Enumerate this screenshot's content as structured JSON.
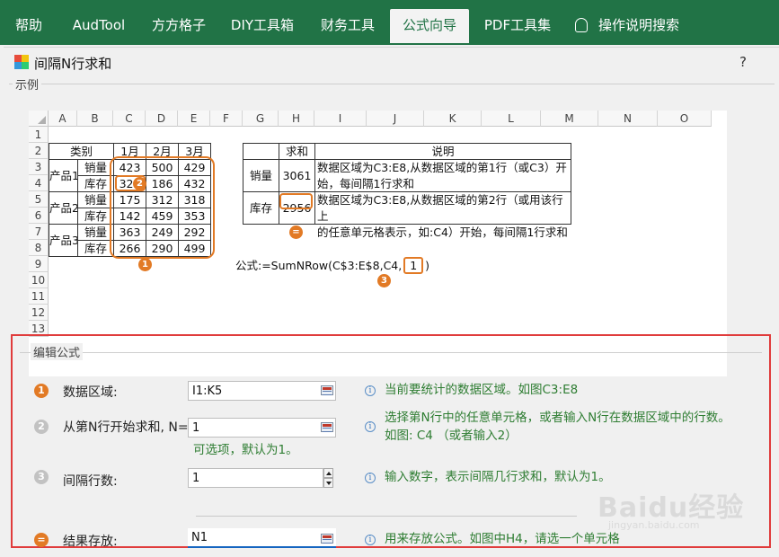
{
  "ribbon": {
    "tabs": [
      "帮助",
      "AudTool",
      "方方格子",
      "DIY工具箱",
      "财务工具",
      "公式向导",
      "PDF工具集",
      "操作说明搜索"
    ],
    "active_tab": "公式向导",
    "accent": "#217346"
  },
  "dialog": {
    "title": "间隔N行求和",
    "help": "?"
  },
  "example": {
    "group_label": "示例",
    "col_headers": [
      "A",
      "B",
      "C",
      "D",
      "E",
      "F",
      "G",
      "H",
      "I",
      "J",
      "K",
      "L",
      "M",
      "N",
      "O"
    ],
    "row_headers": [
      "1",
      "2",
      "3",
      "4",
      "5",
      "6",
      "7",
      "8",
      "9",
      "10",
      "11",
      "12",
      "13"
    ],
    "table1": {
      "header_category": "类别",
      "months": [
        "1月",
        "2月",
        "3月"
      ],
      "products": [
        "产品1",
        "产品2",
        "产品3"
      ],
      "rows": [
        {
          "type": "销量",
          "values": [
            "423",
            "500",
            "429"
          ]
        },
        {
          "type": "库存",
          "values": [
            "329",
            "186",
            "432"
          ]
        },
        {
          "type": "销量",
          "values": [
            "175",
            "312",
            "318"
          ]
        },
        {
          "type": "库存",
          "values": [
            "142",
            "459",
            "353"
          ]
        },
        {
          "type": "销量",
          "values": [
            "363",
            "249",
            "292"
          ]
        },
        {
          "type": "库存",
          "values": [
            "266",
            "290",
            "499"
          ]
        }
      ]
    },
    "table2": {
      "header_sum": "求和",
      "header_desc": "说明",
      "rows": [
        {
          "label": "销量",
          "sum": "3061",
          "desc": [
            "数据区域为C3:E8,从数据区域的第1行（或C3）开",
            "始，每间隔1行求和"
          ]
        },
        {
          "label": "库存",
          "sum": "2956",
          "desc": [
            "数据区域为C3:E8,从数据区域的第2行（或用该行上",
            "的任意单元格表示，如:C4）开始，每间隔1行求和"
          ]
        }
      ]
    },
    "formula_prefix": "公式:=SumNRow(C$3:E$8,C4,",
    "formula_arg": "1",
    "formula_suffix": ")",
    "badges": [
      "1",
      "2",
      "3",
      "="
    ]
  },
  "edit": {
    "group_label": "编辑公式",
    "fields": [
      {
        "badge": "1",
        "label": "数据区域:",
        "value": "I1:K5",
        "hint": [
          "当前要统计的数据区域。如图C3:E8"
        ]
      },
      {
        "badge": "2",
        "label": "从第N行开始求和, N=",
        "value": "1",
        "hint": [
          "选择第N行中的任意单元格，或者输入N行在数据区域中的行数。",
          "如图: C4 （或者输入2）"
        ],
        "note": "可选项，默认为1。"
      },
      {
        "badge": "3",
        "label": "间隔行数:",
        "value": "1",
        "hint": [
          "输入数字，表示间隔几行求和，默认为1。"
        ]
      },
      {
        "badge": "=",
        "label": "结果存放:",
        "value": "N1",
        "hint": [
          "用来存放公式。如图中H4，请选一个单元格"
        ]
      }
    ]
  },
  "watermark": {
    "main": "Baidu经验",
    "sub": "jingyan.baidu.com"
  },
  "colors": {
    "orange": "#e27a25",
    "red_frame": "#e03c3c",
    "hint_green": "#2e7d32",
    "input_underline": "#1565c0"
  }
}
